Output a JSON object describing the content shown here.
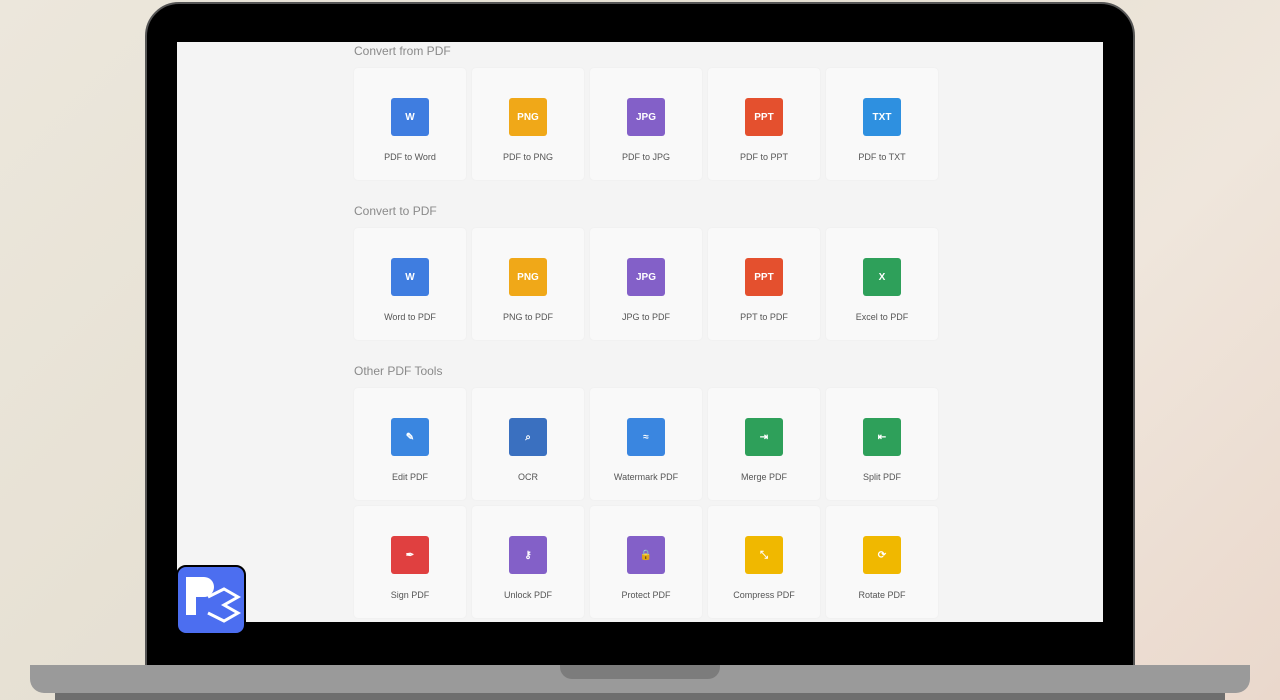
{
  "sections": [
    {
      "title": "Convert from PDF",
      "tools": [
        {
          "label": "PDF to Word",
          "icon": "word-icon",
          "glyph": "W",
          "color": "#3f7de0"
        },
        {
          "label": "PDF to PNG",
          "icon": "png-icon",
          "glyph": "PNG",
          "color": "#f0a818"
        },
        {
          "label": "PDF to JPG",
          "icon": "jpg-icon",
          "glyph": "JPG",
          "color": "#8360c8"
        },
        {
          "label": "PDF to PPT",
          "icon": "ppt-icon",
          "glyph": "PPT",
          "color": "#e4502e"
        },
        {
          "label": "PDF to TXT",
          "icon": "txt-icon",
          "glyph": "TXT",
          "color": "#2e90e0"
        }
      ]
    },
    {
      "title": "Convert to PDF",
      "tools": [
        {
          "label": "Word to PDF",
          "icon": "word-icon",
          "glyph": "W",
          "color": "#3f7de0"
        },
        {
          "label": "PNG to PDF",
          "icon": "png-icon",
          "glyph": "PNG",
          "color": "#f0a818"
        },
        {
          "label": "JPG to PDF",
          "icon": "jpg-icon",
          "glyph": "JPG",
          "color": "#8360c8"
        },
        {
          "label": "PPT to PDF",
          "icon": "ppt-icon",
          "glyph": "PPT",
          "color": "#e4502e"
        },
        {
          "label": "Excel to PDF",
          "icon": "excel-icon",
          "glyph": "X",
          "color": "#2ea05a"
        }
      ]
    },
    {
      "title": "Other PDF Tools",
      "tools": [
        {
          "label": "Edit PDF",
          "icon": "pencil-icon",
          "glyph": "✎",
          "color": "#3a86e0"
        },
        {
          "label": "OCR",
          "icon": "ocr-icon",
          "glyph": "⌕",
          "color": "#3a70c0"
        },
        {
          "label": "Watermark PDF",
          "icon": "watermark-icon",
          "glyph": "≈",
          "color": "#3a86e0"
        },
        {
          "label": "Merge PDF",
          "icon": "merge-icon",
          "glyph": "⇥",
          "color": "#2ea05a"
        },
        {
          "label": "Split PDF",
          "icon": "split-icon",
          "glyph": "⇤",
          "color": "#2ea05a"
        },
        {
          "label": "Sign PDF",
          "icon": "feather-icon",
          "glyph": "✒",
          "color": "#e04040"
        },
        {
          "label": "Unlock PDF",
          "icon": "key-icon",
          "glyph": "⚷",
          "color": "#8360c8"
        },
        {
          "label": "Protect PDF",
          "icon": "lock-icon",
          "glyph": "🔒",
          "color": "#8360c8"
        },
        {
          "label": "Compress PDF",
          "icon": "compress-icon",
          "glyph": "⤡",
          "color": "#f0b800"
        },
        {
          "label": "Rotate PDF",
          "icon": "rotate-icon",
          "glyph": "⟳",
          "color": "#f0b800"
        }
      ]
    }
  ]
}
